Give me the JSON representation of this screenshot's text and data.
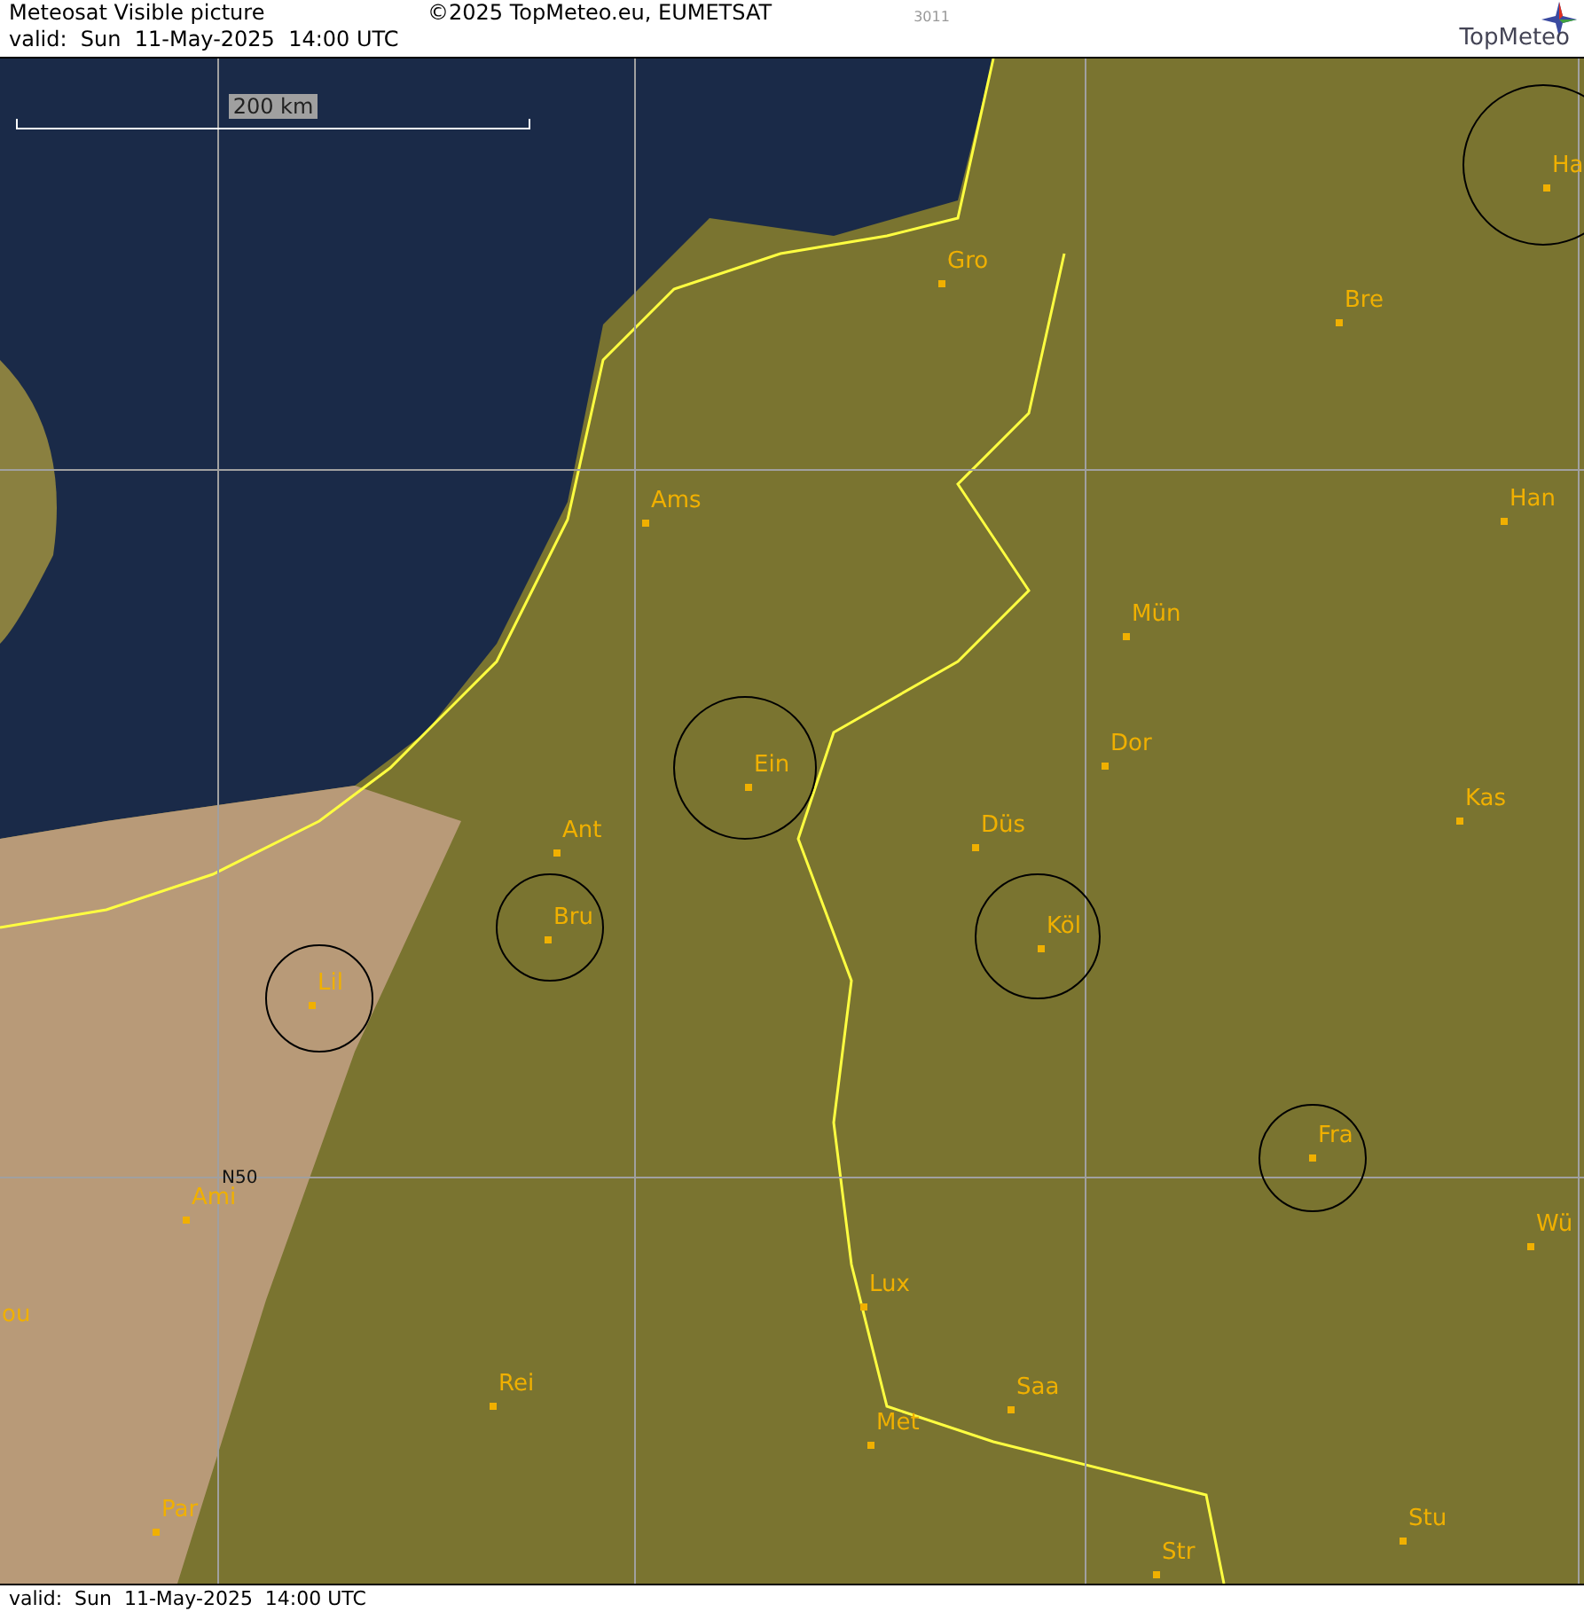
{
  "header": {
    "title": "Meteosat Visible picture",
    "copyright": "©2025 TopMeteo.eu, EUMETSAT",
    "code": "3011",
    "valid": "valid:  Sun  11-May-2025  14:00 UTC",
    "logo": "TopMeteo"
  },
  "scale_bar": {
    "label": "200 km"
  },
  "cities": [
    {
      "name": "Gro"
    },
    {
      "name": "Bre"
    },
    {
      "name": "Ha"
    },
    {
      "name": "Ams"
    },
    {
      "name": "Han"
    },
    {
      "name": "Mün"
    },
    {
      "name": "Ein"
    },
    {
      "name": "Dor"
    },
    {
      "name": "Kas"
    },
    {
      "name": "Ant"
    },
    {
      "name": "Düs"
    },
    {
      "name": "Bru"
    },
    {
      "name": "Köl"
    },
    {
      "name": "Lil"
    },
    {
      "name": "Fra"
    },
    {
      "name": "Ami"
    },
    {
      "name": "Wü"
    },
    {
      "name": "Lux"
    },
    {
      "name": "ou"
    },
    {
      "name": "Rei"
    },
    {
      "name": "Saa"
    },
    {
      "name": "Met"
    },
    {
      "name": "Stu"
    },
    {
      "name": "Par"
    },
    {
      "name": "Str"
    }
  ],
  "grid_label": "N50",
  "footer": {
    "valid": "valid:  Sun  11-May-2025  14:00 UTC"
  }
}
